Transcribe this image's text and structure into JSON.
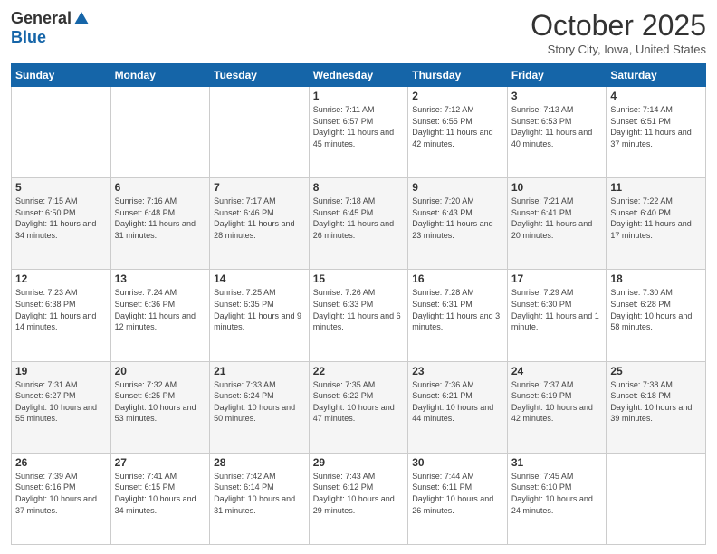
{
  "header": {
    "logo_general": "General",
    "logo_blue": "Blue",
    "month": "October 2025",
    "location": "Story City, Iowa, United States"
  },
  "days_of_week": [
    "Sunday",
    "Monday",
    "Tuesday",
    "Wednesday",
    "Thursday",
    "Friday",
    "Saturday"
  ],
  "weeks": [
    [
      {
        "day": "",
        "info": ""
      },
      {
        "day": "",
        "info": ""
      },
      {
        "day": "",
        "info": ""
      },
      {
        "day": "1",
        "info": "Sunrise: 7:11 AM\nSunset: 6:57 PM\nDaylight: 11 hours and 45 minutes."
      },
      {
        "day": "2",
        "info": "Sunrise: 7:12 AM\nSunset: 6:55 PM\nDaylight: 11 hours and 42 minutes."
      },
      {
        "day": "3",
        "info": "Sunrise: 7:13 AM\nSunset: 6:53 PM\nDaylight: 11 hours and 40 minutes."
      },
      {
        "day": "4",
        "info": "Sunrise: 7:14 AM\nSunset: 6:51 PM\nDaylight: 11 hours and 37 minutes."
      }
    ],
    [
      {
        "day": "5",
        "info": "Sunrise: 7:15 AM\nSunset: 6:50 PM\nDaylight: 11 hours and 34 minutes."
      },
      {
        "day": "6",
        "info": "Sunrise: 7:16 AM\nSunset: 6:48 PM\nDaylight: 11 hours and 31 minutes."
      },
      {
        "day": "7",
        "info": "Sunrise: 7:17 AM\nSunset: 6:46 PM\nDaylight: 11 hours and 28 minutes."
      },
      {
        "day": "8",
        "info": "Sunrise: 7:18 AM\nSunset: 6:45 PM\nDaylight: 11 hours and 26 minutes."
      },
      {
        "day": "9",
        "info": "Sunrise: 7:20 AM\nSunset: 6:43 PM\nDaylight: 11 hours and 23 minutes."
      },
      {
        "day": "10",
        "info": "Sunrise: 7:21 AM\nSunset: 6:41 PM\nDaylight: 11 hours and 20 minutes."
      },
      {
        "day": "11",
        "info": "Sunrise: 7:22 AM\nSunset: 6:40 PM\nDaylight: 11 hours and 17 minutes."
      }
    ],
    [
      {
        "day": "12",
        "info": "Sunrise: 7:23 AM\nSunset: 6:38 PM\nDaylight: 11 hours and 14 minutes."
      },
      {
        "day": "13",
        "info": "Sunrise: 7:24 AM\nSunset: 6:36 PM\nDaylight: 11 hours and 12 minutes."
      },
      {
        "day": "14",
        "info": "Sunrise: 7:25 AM\nSunset: 6:35 PM\nDaylight: 11 hours and 9 minutes."
      },
      {
        "day": "15",
        "info": "Sunrise: 7:26 AM\nSunset: 6:33 PM\nDaylight: 11 hours and 6 minutes."
      },
      {
        "day": "16",
        "info": "Sunrise: 7:28 AM\nSunset: 6:31 PM\nDaylight: 11 hours and 3 minutes."
      },
      {
        "day": "17",
        "info": "Sunrise: 7:29 AM\nSunset: 6:30 PM\nDaylight: 11 hours and 1 minute."
      },
      {
        "day": "18",
        "info": "Sunrise: 7:30 AM\nSunset: 6:28 PM\nDaylight: 10 hours and 58 minutes."
      }
    ],
    [
      {
        "day": "19",
        "info": "Sunrise: 7:31 AM\nSunset: 6:27 PM\nDaylight: 10 hours and 55 minutes."
      },
      {
        "day": "20",
        "info": "Sunrise: 7:32 AM\nSunset: 6:25 PM\nDaylight: 10 hours and 53 minutes."
      },
      {
        "day": "21",
        "info": "Sunrise: 7:33 AM\nSunset: 6:24 PM\nDaylight: 10 hours and 50 minutes."
      },
      {
        "day": "22",
        "info": "Sunrise: 7:35 AM\nSunset: 6:22 PM\nDaylight: 10 hours and 47 minutes."
      },
      {
        "day": "23",
        "info": "Sunrise: 7:36 AM\nSunset: 6:21 PM\nDaylight: 10 hours and 44 minutes."
      },
      {
        "day": "24",
        "info": "Sunrise: 7:37 AM\nSunset: 6:19 PM\nDaylight: 10 hours and 42 minutes."
      },
      {
        "day": "25",
        "info": "Sunrise: 7:38 AM\nSunset: 6:18 PM\nDaylight: 10 hours and 39 minutes."
      }
    ],
    [
      {
        "day": "26",
        "info": "Sunrise: 7:39 AM\nSunset: 6:16 PM\nDaylight: 10 hours and 37 minutes."
      },
      {
        "day": "27",
        "info": "Sunrise: 7:41 AM\nSunset: 6:15 PM\nDaylight: 10 hours and 34 minutes."
      },
      {
        "day": "28",
        "info": "Sunrise: 7:42 AM\nSunset: 6:14 PM\nDaylight: 10 hours and 31 minutes."
      },
      {
        "day": "29",
        "info": "Sunrise: 7:43 AM\nSunset: 6:12 PM\nDaylight: 10 hours and 29 minutes."
      },
      {
        "day": "30",
        "info": "Sunrise: 7:44 AM\nSunset: 6:11 PM\nDaylight: 10 hours and 26 minutes."
      },
      {
        "day": "31",
        "info": "Sunrise: 7:45 AM\nSunset: 6:10 PM\nDaylight: 10 hours and 24 minutes."
      },
      {
        "day": "",
        "info": ""
      }
    ]
  ]
}
